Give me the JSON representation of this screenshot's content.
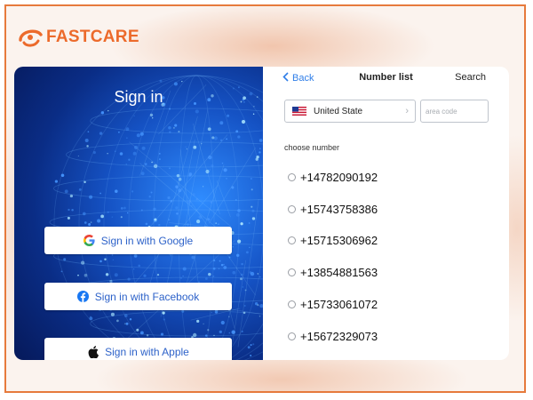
{
  "brand": {
    "name": "FASTCARE",
    "accent": "#ec6a2b"
  },
  "signin": {
    "title": "Sign in",
    "buttons": [
      {
        "label": "Sign in with Google",
        "icon": "google-icon"
      },
      {
        "label": "Sign in with Facebook",
        "icon": "facebook-icon"
      },
      {
        "label": "Sign in with Apple",
        "icon": "apple-icon"
      }
    ]
  },
  "number_list": {
    "back_label": "Back",
    "title": "Number list",
    "search_label": "Search",
    "country": "United State",
    "area_placeholder": "area code",
    "choose_label": "choose number",
    "numbers": [
      "+14782090192",
      "+15743758386",
      "+15715306962",
      "+13854881563",
      "+15733061072",
      "+15672329073"
    ]
  },
  "colors": {
    "frame_border": "#e67a3c",
    "link_blue": "#2f7ee8",
    "button_text": "#2d62c9"
  }
}
